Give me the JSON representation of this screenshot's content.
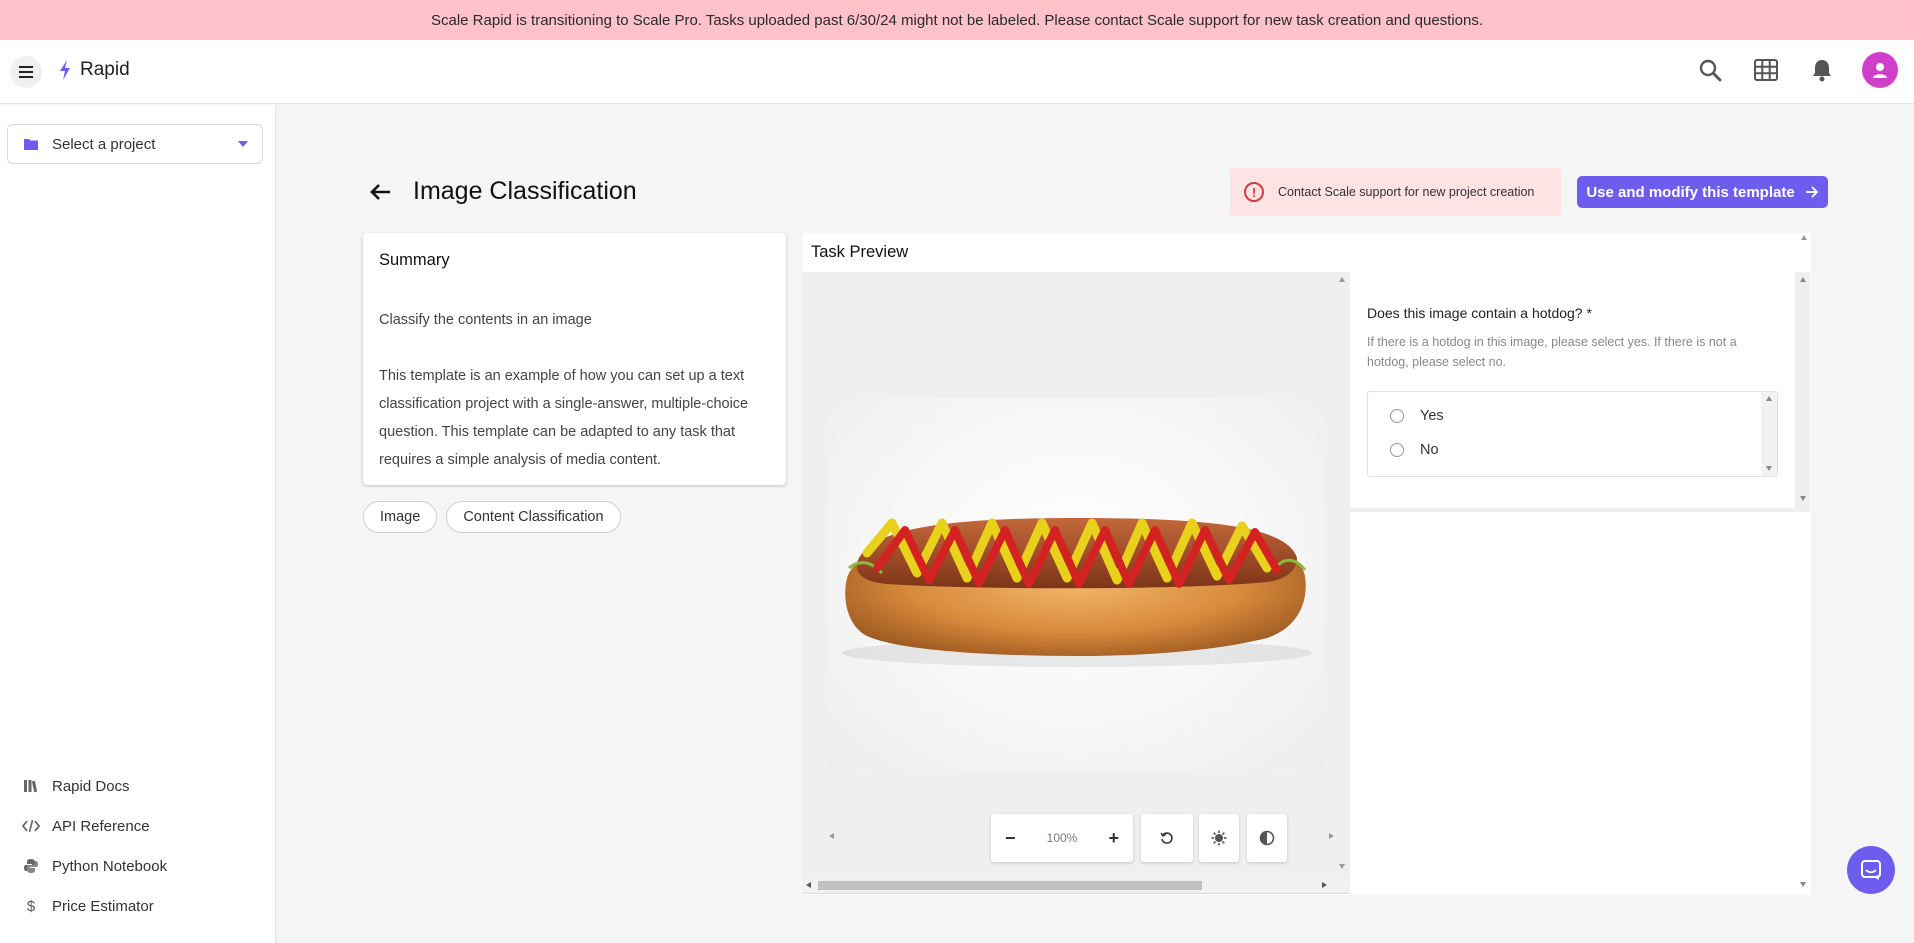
{
  "banner": {
    "text": "Scale Rapid is transitioning to Scale Pro. Tasks uploaded past 6/30/24 might not be labeled. Please contact Scale support for new task creation and questions."
  },
  "topbar": {
    "app_name": "Rapid",
    "icons": [
      "menu-icon",
      "search-icon",
      "apps-grid-icon",
      "bell-icon",
      "user-avatar"
    ]
  },
  "sidebar": {
    "project_select": {
      "label": "Select a project"
    },
    "links": [
      {
        "label": "Rapid Docs",
        "icon": "library-icon"
      },
      {
        "label": "API Reference",
        "icon": "code-icon"
      },
      {
        "label": "Python Notebook",
        "icon": "python-icon"
      },
      {
        "label": "Price Estimator",
        "icon": "dollar-icon"
      }
    ]
  },
  "page": {
    "title": "Image Classification",
    "alert": "Contact Scale support for new project creation",
    "use_button": "Use and modify this template"
  },
  "summary": {
    "title": "Summary",
    "short": "Classify the contents in an image",
    "long": "This template is an example of how you can set up a text classification project with a single-answer, multiple-choice question. This template can be adapted to any task that requires a simple analysis of media content."
  },
  "tags": [
    "Image",
    "Content Classification"
  ],
  "preview": {
    "title": "Task Preview",
    "zoom": "100%",
    "question": {
      "title": "Does this image contain a hotdog? *",
      "help": "If there is a hotdog in this image, please select yes. If there is not a hotdog, please select no.",
      "options": [
        "Yes",
        "No"
      ]
    }
  },
  "colors": {
    "accent": "#6d5cee",
    "banner_bg": "#ffc2cb",
    "alert_bg": "#fde3e3",
    "alert_icon": "#d43c3c",
    "avatar": "#d03fc9"
  }
}
